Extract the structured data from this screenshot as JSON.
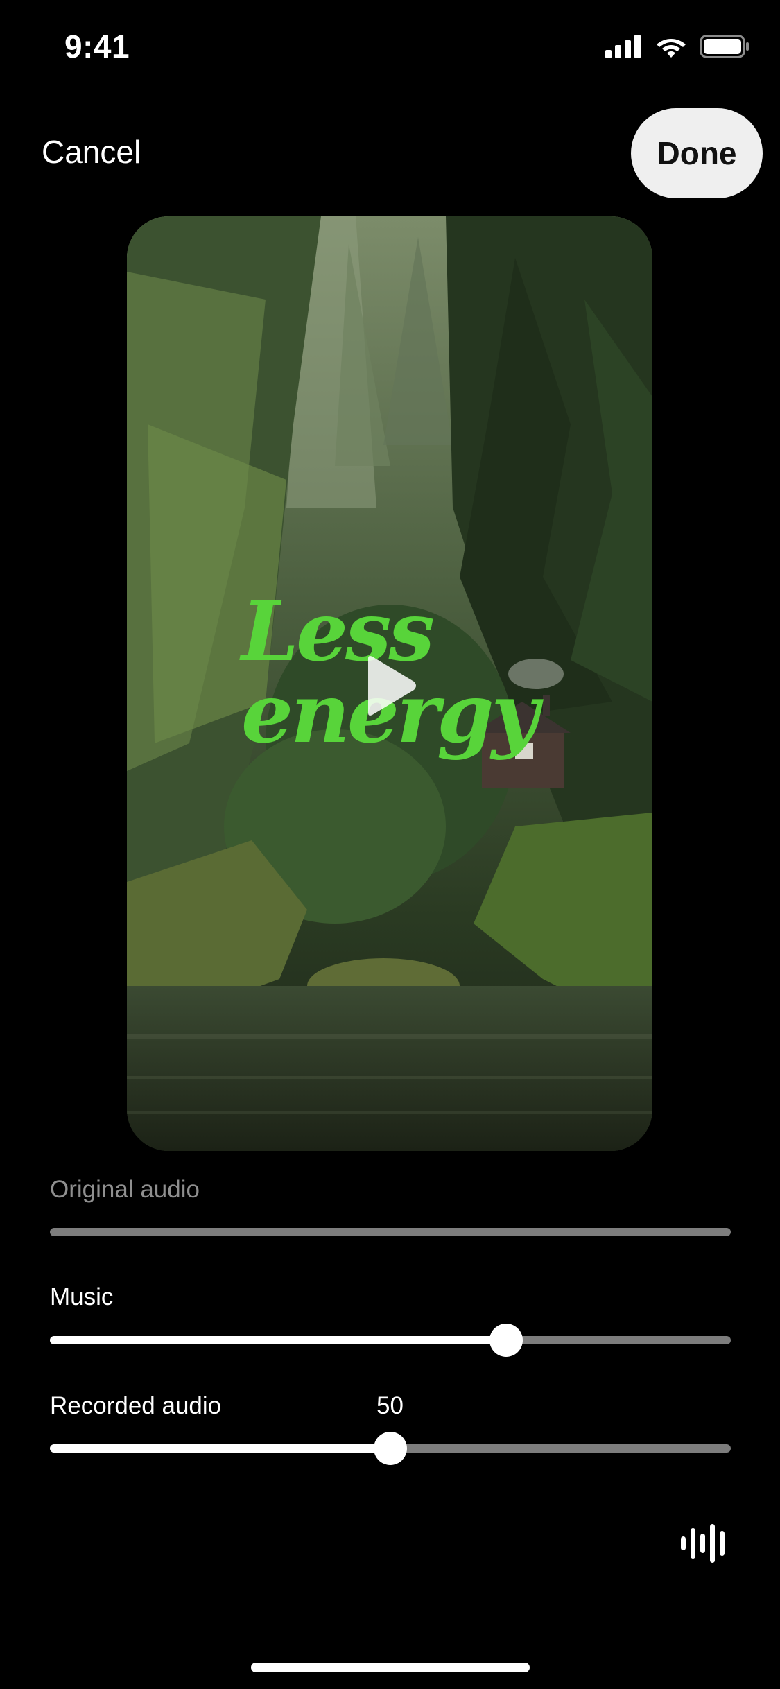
{
  "status_bar": {
    "time": "9:41",
    "icons": [
      "cellular-signal-icon",
      "wifi-icon",
      "battery-icon"
    ]
  },
  "nav": {
    "cancel_label": "Cancel",
    "done_label": "Done"
  },
  "preview": {
    "overlay_text": [
      "Less",
      "energy"
    ],
    "overlay_color": "#58d43a",
    "play_icon": "play-icon"
  },
  "audio": {
    "original": {
      "label": "Original audio",
      "enabled": false,
      "level": 0
    },
    "music": {
      "label": "Music",
      "level": 0.67
    },
    "recorded": {
      "label": "Recorded audio",
      "value_text": "50",
      "level": 0.5
    }
  },
  "waveform_icon": "waveform-icon",
  "colors": {
    "background": "#000000",
    "done_button": "#efefef",
    "track": "#7d7d7d",
    "fill": "#ffffff",
    "disabled_label": "#8f8f8f"
  }
}
